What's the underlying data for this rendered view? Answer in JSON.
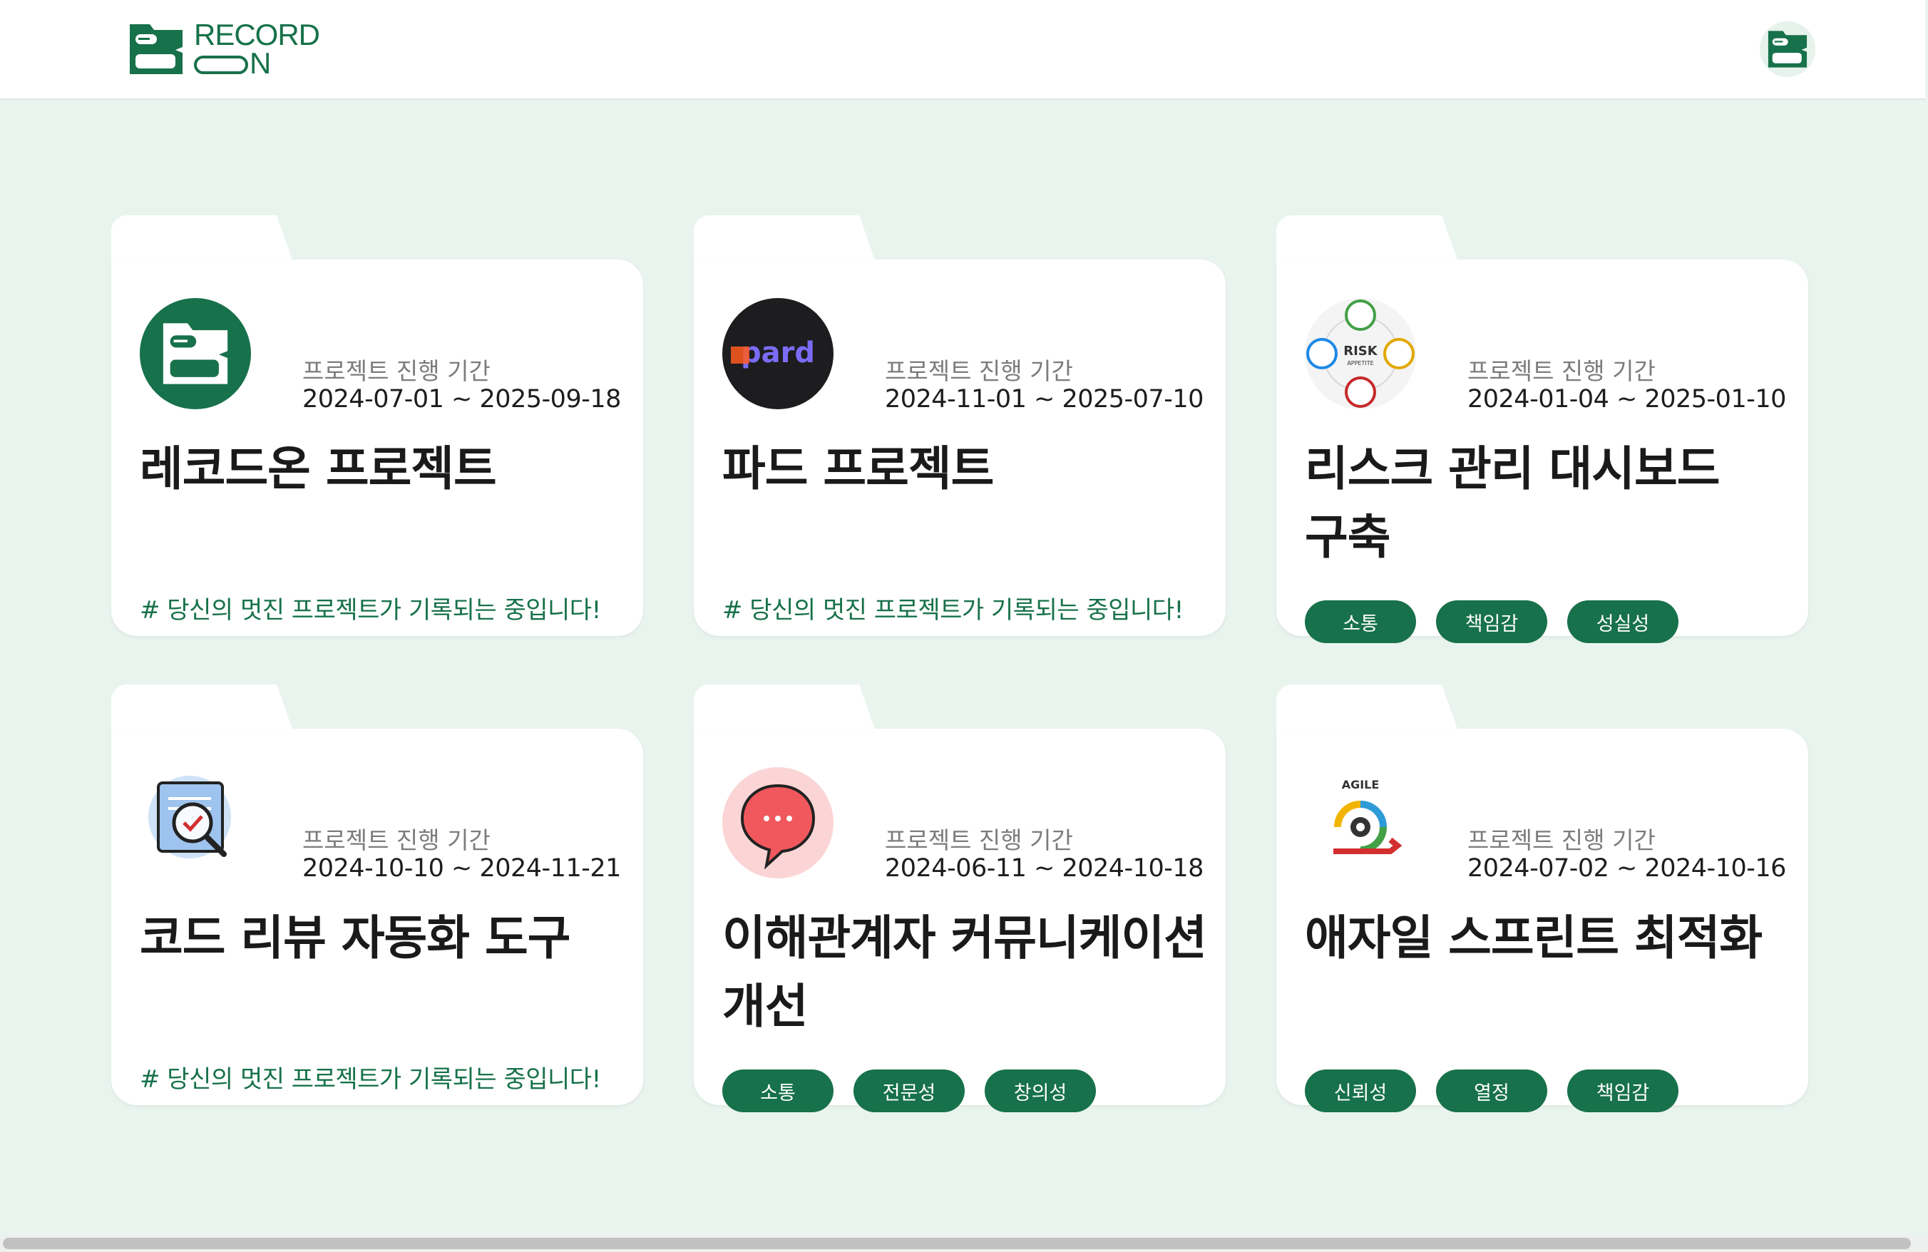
{
  "header": {
    "logo_line1": "RECORD",
    "logo_line2": "N",
    "logo_icon": "record-on-logo-icon",
    "profile_icon": "record-on-avatar-icon",
    "brand_color": "#17714a"
  },
  "colors": {
    "background": "#eaf4ef",
    "card": "#ffffff",
    "accent": "#17714a",
    "muted_text": "#7c7c7c"
  },
  "projects": [
    {
      "thumbnail": "record-on-logo-icon",
      "period_label": "프로젝트 진행 기간",
      "period": "2024-07-01 ~ 2025-09-18",
      "title": "레코드온 프로젝트",
      "note": "# 당신의 멋진 프로젝트가 기록되는 중입니다!"
    },
    {
      "thumbnail": "pard-logo-icon",
      "thumb_text": "pard",
      "period_label": "프로젝트 진행 기간",
      "period": "2024-11-01 ~ 2025-07-10",
      "title": "파드 프로젝트",
      "note": "# 당신의 멋진 프로젝트가 기록되는 중입니다!"
    },
    {
      "thumbnail": "risk-appetite-icon",
      "thumb_text": "RISK",
      "thumb_subtext": "APPETITE",
      "period_label": "프로젝트 진행 기간",
      "period": "2024-01-04 ~ 2025-01-10",
      "title": "리스크 관리 대시보드 구축",
      "tags": [
        "소통",
        "책임감",
        "성실성"
      ]
    },
    {
      "thumbnail": "code-review-magnifier-icon",
      "period_label": "프로젝트 진행 기간",
      "period": "2024-10-10 ~ 2024-11-21",
      "title": "코드 리뷰 자동화 도구",
      "note": "# 당신의 멋진 프로젝트가 기록되는 중입니다!"
    },
    {
      "thumbnail": "chat-bubble-icon",
      "period_label": "프로젝트 진행 기간",
      "period": "2024-06-11 ~ 2024-10-18",
      "title": "이해관계자 커뮤니케이션 개선",
      "tags": [
        "소통",
        "전문성",
        "창의성"
      ]
    },
    {
      "thumbnail": "agile-cycle-icon",
      "thumb_text": "AGILE",
      "period_label": "프로젝트 진행 기간",
      "period": "2024-07-02 ~ 2024-10-16",
      "title": "애자일 스프린트 최적화",
      "tags": [
        "신뢰성",
        "열정",
        "책임감"
      ]
    }
  ]
}
